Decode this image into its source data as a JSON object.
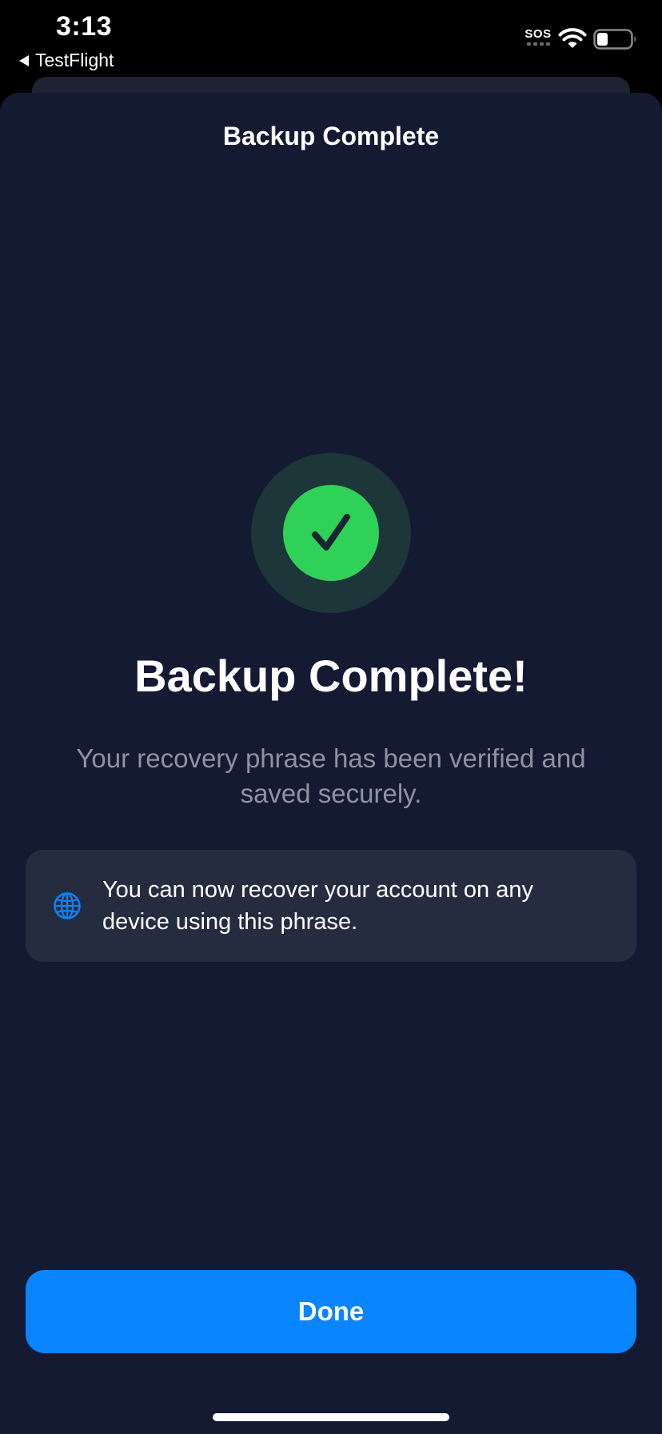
{
  "status_bar": {
    "time": "3:13",
    "back_app": "TestFlight",
    "sos": "SOS",
    "icons": [
      "sos-indicator",
      "wifi-icon",
      "battery-icon"
    ]
  },
  "sheet": {
    "title": "Backup Complete"
  },
  "success": {
    "icon": "checkmark-icon",
    "headline": "Backup Complete!",
    "subtitle": "Your recovery phrase has been verified and saved securely."
  },
  "info_card": {
    "icon": "globe-icon",
    "text": "You can now recover your account on any device using this phrase."
  },
  "actions": {
    "done_label": "Done"
  },
  "colors": {
    "background": "#141a31",
    "card": "#262c40",
    "success_green": "#30d158",
    "success_ring": "#1c3639",
    "accent_blue": "#0a84ff",
    "secondary_text": "#8e93a3"
  }
}
